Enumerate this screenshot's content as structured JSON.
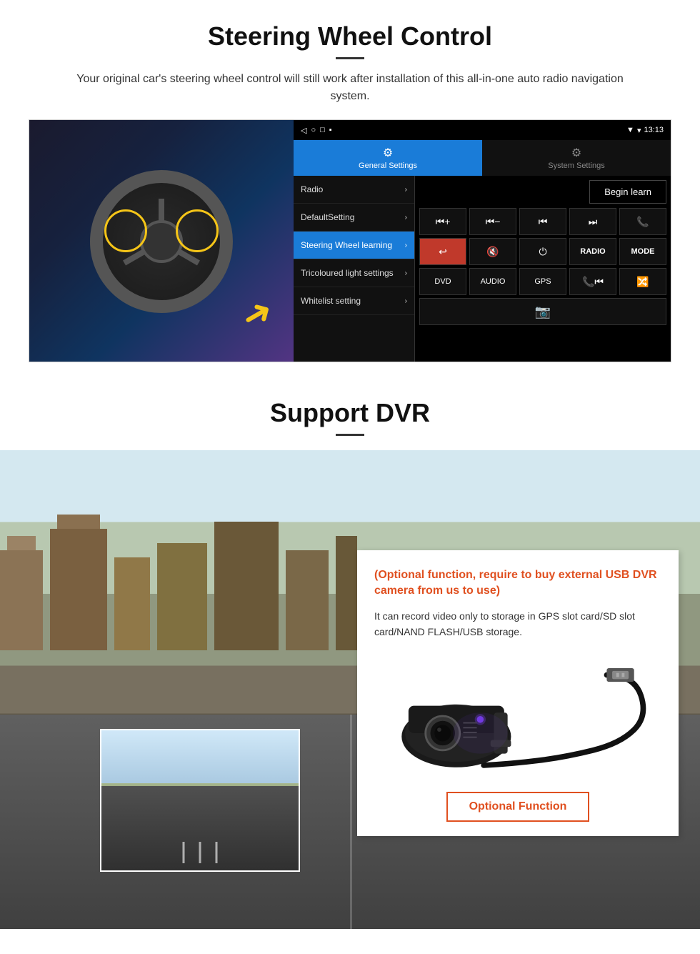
{
  "steering": {
    "title": "Steering Wheel Control",
    "description": "Your original car's steering wheel control will still work after installation of this all-in-one auto radio navigation system.",
    "ui": {
      "statusbar": {
        "time": "13:13",
        "nav_icons": [
          "◁",
          "○",
          "□",
          "▪"
        ]
      },
      "tabs": [
        {
          "label": "General Settings",
          "icon": "⚙",
          "active": true
        },
        {
          "label": "System Settings",
          "icon": "🌐",
          "active": false
        }
      ],
      "menu_items": [
        {
          "label": "Radio",
          "active": false
        },
        {
          "label": "DefaultSetting",
          "active": false
        },
        {
          "label": "Steering Wheel learning",
          "active": true
        },
        {
          "label": "Tricoloured light settings",
          "active": false
        },
        {
          "label": "Whitelist setting",
          "active": false
        }
      ],
      "begin_learn_label": "Begin learn",
      "control_buttons": [
        [
          "⏮+",
          "⏮−",
          "⏮",
          "⏭",
          "📞"
        ],
        [
          "↩",
          "🔇",
          "⏻",
          "RADIO",
          "MODE"
        ],
        [
          "DVD",
          "AUDIO",
          "GPS",
          "📞⏮",
          "🔀⏭"
        ],
        [
          "📷"
        ]
      ]
    }
  },
  "dvr": {
    "title": "Support DVR",
    "optional_warning": "(Optional function, require to buy external USB DVR camera from us to use)",
    "description": "It can record video only to storage in GPS slot card/SD slot card/NAND FLASH/USB storage.",
    "optional_function_label": "Optional Function"
  }
}
